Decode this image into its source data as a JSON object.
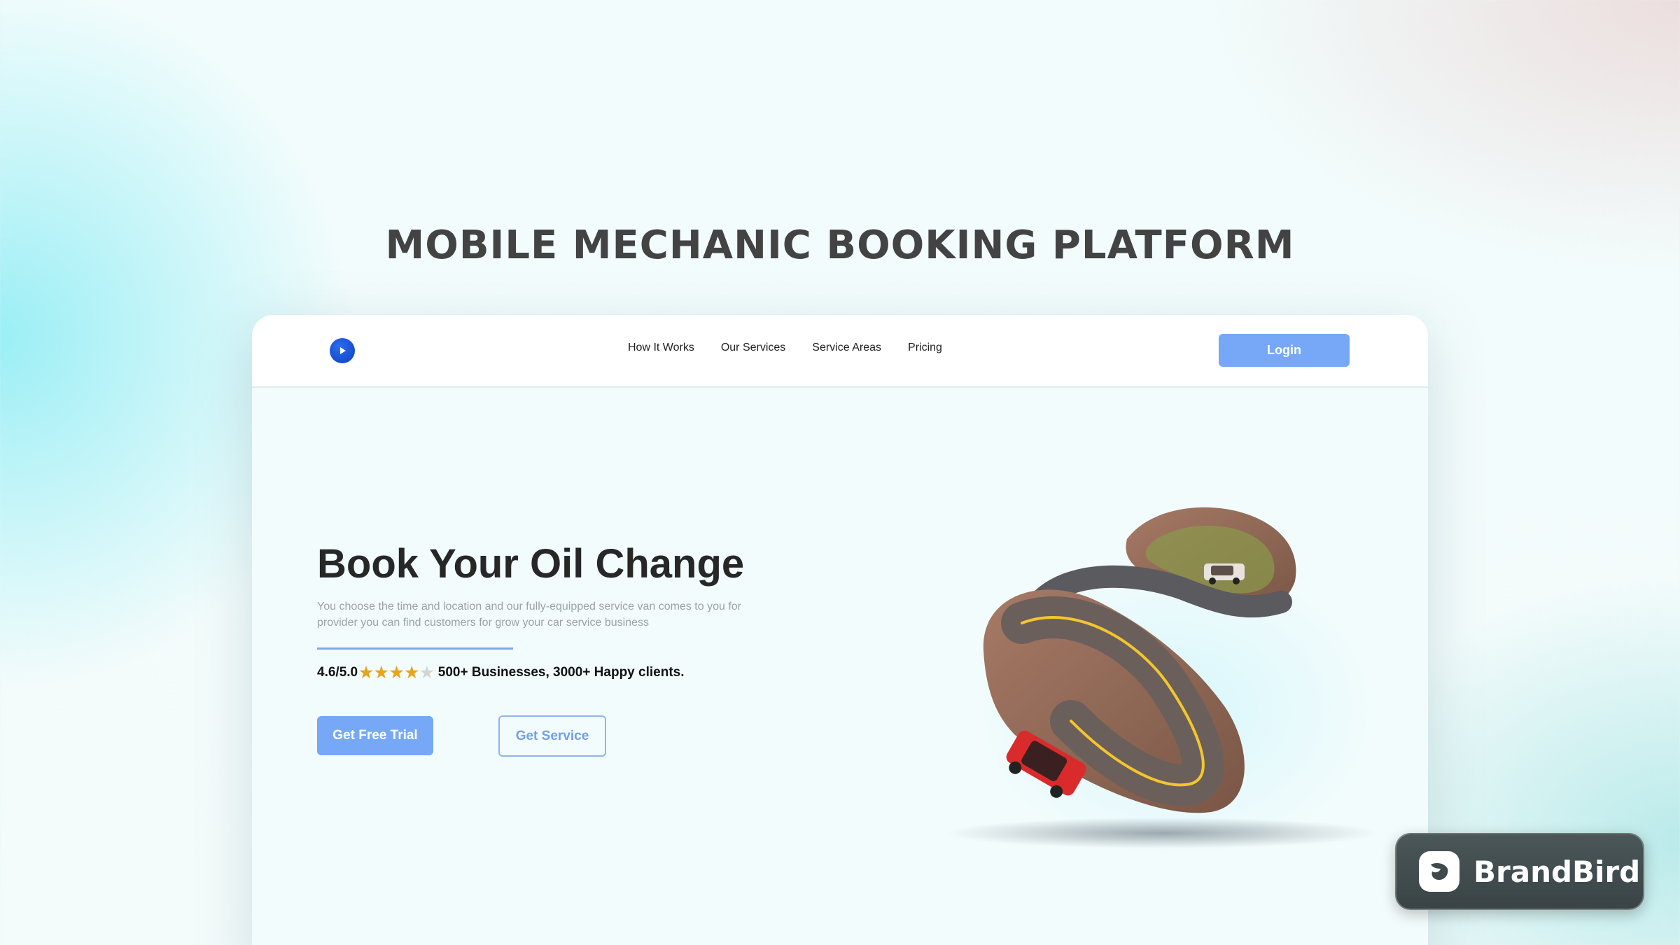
{
  "page": {
    "heading": "MOBILE MECHANIC BOOKING PLATFORM"
  },
  "nav": {
    "logo_icon": "play-circle-icon",
    "links": [
      {
        "label": "How It Works"
      },
      {
        "label": "Our Services"
      },
      {
        "label": "Service Areas"
      },
      {
        "label": "Pricing"
      }
    ],
    "login_label": "Login"
  },
  "hero": {
    "title": "Book Your Oil Change",
    "description": "You choose the time and location and our fully-equipped service van comes to you for provider you can find customers for grow your car service business",
    "rating": {
      "score": "4.6/5.0",
      "stars_filled": 4,
      "stars_total": 5,
      "summary": "500+ Businesses, 3000+ Happy clients."
    },
    "primary_cta": "Get Free Trial",
    "secondary_cta": "Get Service",
    "image": "winding-road-with-cars-illustration"
  },
  "badge": {
    "label": "BrandBird",
    "icon": "brandbird-logo-icon"
  },
  "colors": {
    "accent": "#76a8f7",
    "heading_text": "#434343",
    "star": "#e8a317",
    "car": "#d92b2b",
    "road": "#8b6e62"
  }
}
